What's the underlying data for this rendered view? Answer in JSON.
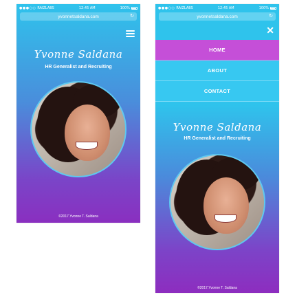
{
  "status_bar": {
    "carrier": "RAIZLABS",
    "time": "12:45 AM",
    "battery": "100%"
  },
  "browser": {
    "url": "yvonnetsaldana.com"
  },
  "site": {
    "name": "Yvonne Saldana",
    "role": "HR Generalist and Recruiting",
    "footer": "©2017.Yvonne T. Saldana"
  },
  "nav": {
    "items": [
      {
        "label": "HOME",
        "active": true
      },
      {
        "label": "ABOUT",
        "active": false
      },
      {
        "label": "CONTACT",
        "active": false
      }
    ]
  },
  "colors": {
    "accent": "#c54fd8",
    "top": "#2fc3ec",
    "bottom": "#8d2dbf"
  },
  "icons": {
    "menu": "hamburger-menu-icon",
    "close": "close-icon",
    "reload": "reload-icon"
  }
}
